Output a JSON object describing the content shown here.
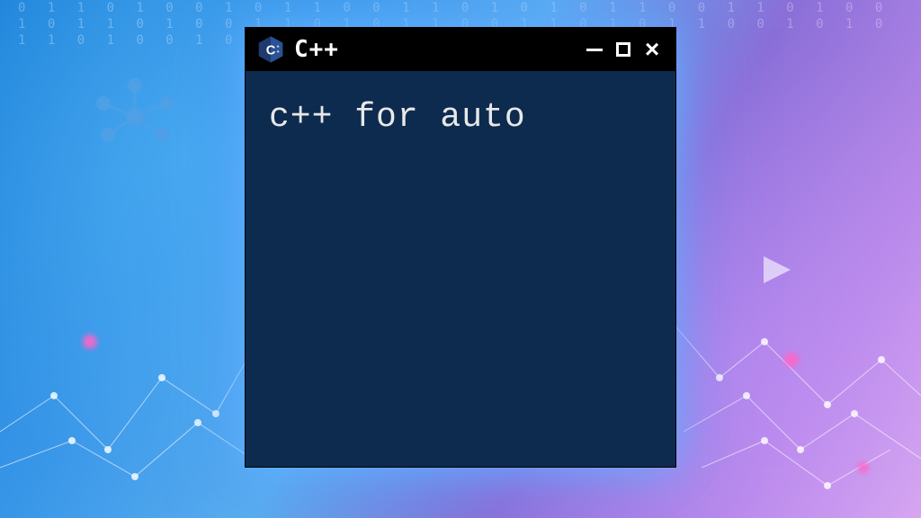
{
  "window": {
    "title": "C++",
    "content_text": "c++ for auto"
  },
  "background": {
    "binary_text": "0 1 1 0 1 0 0 1 0 1 1 0 0 1 1 0 1 0 1 0 1 1 0 0 1 1 0 1 0 0 1 0 1 1 0 1 0 0 1 1 0 1 0 1 1 0 0 1 1 0 1 0 1 1 0 0 1 0 1 0 1 1 0 1 0 0 1 0 1 1"
  }
}
